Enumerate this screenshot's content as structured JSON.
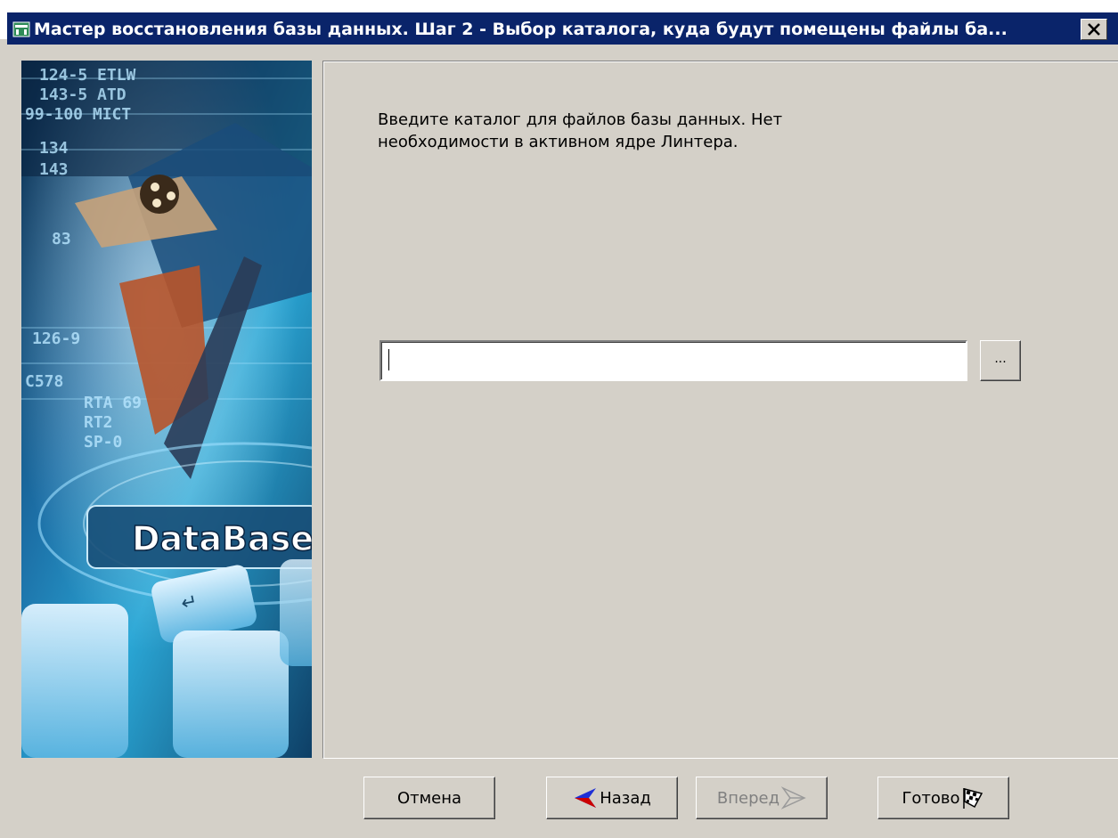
{
  "window": {
    "title": "Мастер восстановления базы данных. Шаг 2 - Выбор каталога, куда будут помещены файлы ба...",
    "close_label": "X"
  },
  "side_image": {
    "brand_text": "DataBase",
    "ticker_lines": [
      "124-5 ETLW",
      "143-5 ATD",
      "99-100 MICT",
      "134",
      "143",
      "83",
      "126-9",
      "C578",
      "RTA 69",
      "RT2",
      "SP-0"
    ]
  },
  "content": {
    "instruction_line1": "Введите каталог для файлов базы данных. Нет",
    "instruction_line2": "необходимости в активном ядре Линтера.",
    "path_value": "",
    "browse_label": "..."
  },
  "buttons": {
    "cancel": "Отмена",
    "back": "Назад",
    "next": "Вперед",
    "finish": "Готово"
  },
  "colors": {
    "title_bar": "#0a246a",
    "dialog_bg": "#d4d0c8",
    "back_arrow": "#1e2fd6",
    "back_arrow_red": "#cc0000"
  }
}
